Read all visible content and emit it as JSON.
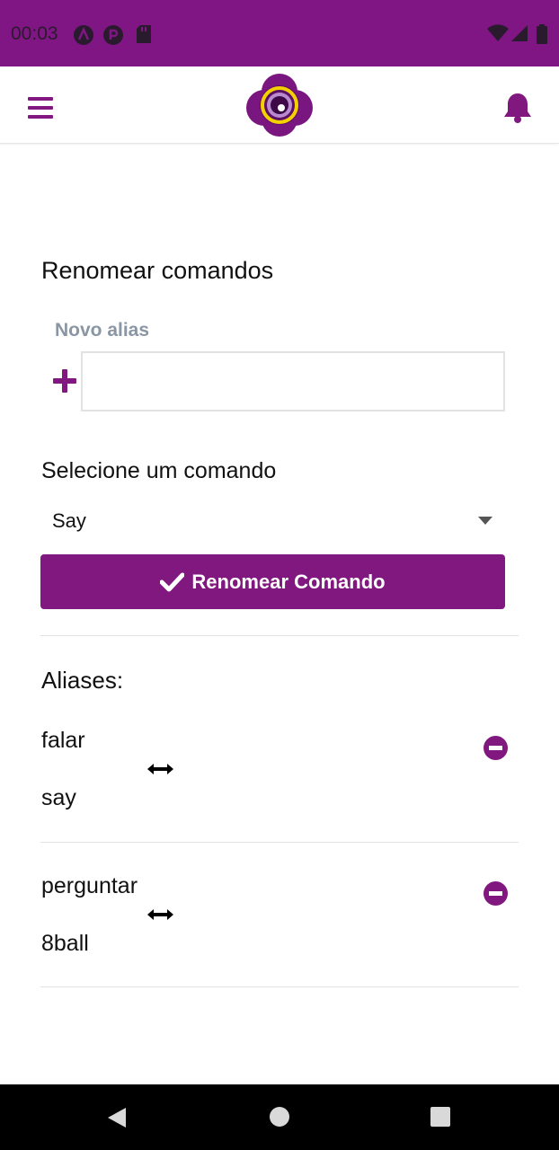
{
  "status_bar": {
    "time": "00:03",
    "background": "#7f1684",
    "left_icons": [
      "app-a-icon",
      "app-p-icon",
      "sd-card-icon"
    ],
    "right_icons": [
      "wifi-icon",
      "signal-icon",
      "battery-icon"
    ]
  },
  "app_bar": {
    "left_icon": "hamburger-menu-icon",
    "logo_icon": "app-logo-icon",
    "right_icon": "bell-icon"
  },
  "rename_section": {
    "title": "Renomear comandos",
    "alias_label": "Novo alias",
    "alias_value": "",
    "alias_placeholder": "",
    "add_icon": "plus-icon",
    "select_label": "Selecione um comando",
    "select_value": "Say",
    "button_label": "Renomear Comando",
    "button_icon": "check-icon"
  },
  "aliases": {
    "title": "Aliases:",
    "items": [
      {
        "alias": "falar",
        "command": "say"
      },
      {
        "alias": "perguntar",
        "command": "8ball"
      }
    ],
    "link_icon": "double-arrow-icon",
    "remove_icon": "minus-circle-icon"
  },
  "nav_bar": {
    "icons": [
      "back-icon",
      "home-icon",
      "recents-icon"
    ]
  },
  "colors": {
    "primary": "#80187f",
    "status_bar": "#7f1684",
    "label_gray": "#8a96a3",
    "logo_yellow": "#f5d000"
  }
}
